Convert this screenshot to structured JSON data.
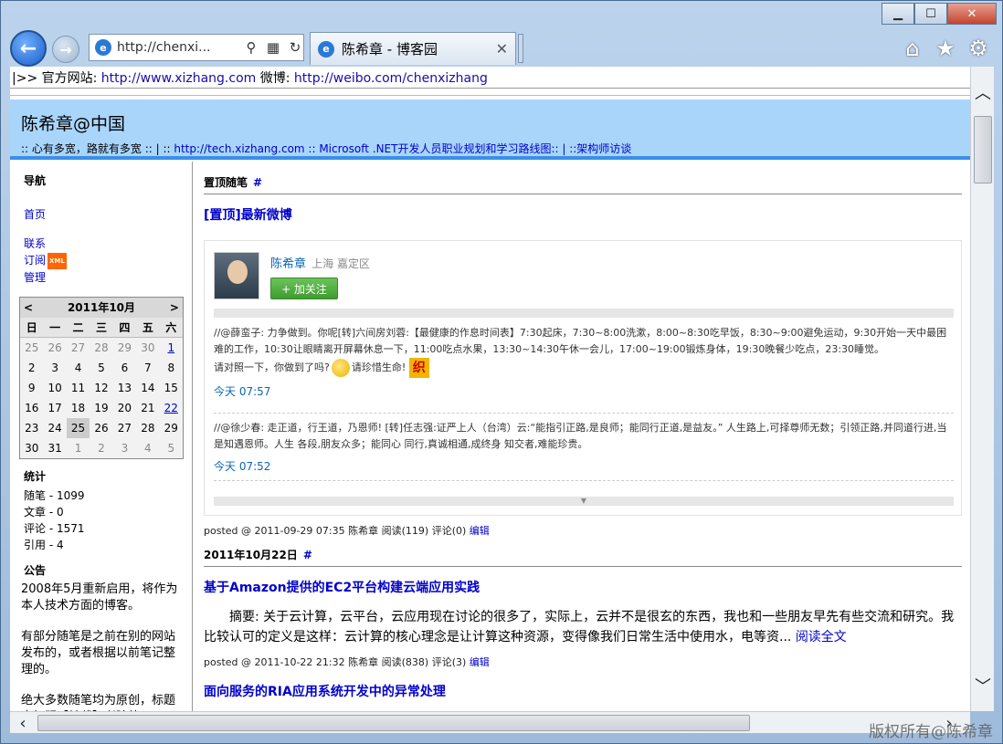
{
  "browser": {
    "address": "http://chenxi...",
    "tab_title": "陈希章 - 博客园",
    "ie_glyph": "e"
  },
  "topline": {
    "prefix": "|>> 官方网站: ",
    "site_url": "http://www.xizhang.com",
    "weibo_label": " 微博: ",
    "weibo_url": "http://weibo.com/chenxizhang"
  },
  "header": {
    "title": "陈希章@中国",
    "motto": ":: 心有多宽，路就有多宽 :: | :: ",
    "tech_link": "http://tech.xizhang.com",
    "link2": " :: Microsoft .NET开发人员职业规划和学习路线图:: | ::架构师访谈"
  },
  "sidebar": {
    "nav_heading": "导航",
    "nav": [
      "首页",
      "联系",
      "订阅",
      "管理"
    ],
    "xml_badge": "XML",
    "calendar": {
      "prev": "<",
      "title": "2011年10月",
      "next": ">",
      "dows": [
        "日",
        "一",
        "二",
        "三",
        "四",
        "五",
        "六"
      ],
      "days": [
        {
          "d": "25",
          "t": "other"
        },
        {
          "d": "26",
          "t": "other"
        },
        {
          "d": "27",
          "t": "other"
        },
        {
          "d": "28",
          "t": "other"
        },
        {
          "d": "29",
          "t": "other"
        },
        {
          "d": "30",
          "t": "other"
        },
        {
          "d": "1",
          "t": "link"
        },
        {
          "d": "2",
          "t": ""
        },
        {
          "d": "3",
          "t": ""
        },
        {
          "d": "4",
          "t": ""
        },
        {
          "d": "5",
          "t": ""
        },
        {
          "d": "6",
          "t": ""
        },
        {
          "d": "7",
          "t": ""
        },
        {
          "d": "8",
          "t": ""
        },
        {
          "d": "9",
          "t": ""
        },
        {
          "d": "10",
          "t": ""
        },
        {
          "d": "11",
          "t": ""
        },
        {
          "d": "12",
          "t": ""
        },
        {
          "d": "13",
          "t": ""
        },
        {
          "d": "14",
          "t": ""
        },
        {
          "d": "15",
          "t": ""
        },
        {
          "d": "16",
          "t": ""
        },
        {
          "d": "17",
          "t": ""
        },
        {
          "d": "18",
          "t": ""
        },
        {
          "d": "19",
          "t": ""
        },
        {
          "d": "20",
          "t": ""
        },
        {
          "d": "21",
          "t": ""
        },
        {
          "d": "22",
          "t": "link"
        },
        {
          "d": "23",
          "t": ""
        },
        {
          "d": "24",
          "t": ""
        },
        {
          "d": "25",
          "t": "today"
        },
        {
          "d": "26",
          "t": ""
        },
        {
          "d": "27",
          "t": ""
        },
        {
          "d": "28",
          "t": ""
        },
        {
          "d": "29",
          "t": ""
        },
        {
          "d": "30",
          "t": ""
        },
        {
          "d": "31",
          "t": ""
        },
        {
          "d": "1",
          "t": "other"
        },
        {
          "d": "2",
          "t": "other"
        },
        {
          "d": "3",
          "t": "other"
        },
        {
          "d": "4",
          "t": "other"
        },
        {
          "d": "5",
          "t": "other"
        }
      ]
    },
    "stats_heading": "统计",
    "stats": [
      "随笔 - 1099",
      "文章 - 0",
      "评论 - 1571",
      "引用 - 4"
    ],
    "notice_heading": "公告",
    "notice": [
      "2008年5月重新启用，将作为本人技术方面的博客。",
      "有部分随笔是之前在别的网站发布的，或者根据以前笔记整理的。",
      "绝大多数随笔均为原创，标题中标明【转载】者除外。"
    ]
  },
  "main": {
    "section1": {
      "title": "置顶随笔",
      "hash": "#"
    },
    "post1": {
      "title": "[置顶]最新微博",
      "foot_prefix": "posted @ 2011-09-29 07:35 陈希章 阅读(119) 评论(0) ",
      "edit": "编辑"
    },
    "weibo": {
      "name": "陈希章",
      "location": "上海 嘉定区",
      "follow": "+ 加关注",
      "item1_a": "//@薛蛮子: 力争做到。你呢[转]六间房刘蓉:【最健康的作息时间表】7:30起床，7:30~8:00洗漱，8:00~8:30吃早饭，8:30~9:00避免运动，9:30开始一天中最困难的工作，10:30让眼睛离开屏幕休息一下，11:00吃点水果，13:30~14:30午休一会儿，17:00~19:00锻炼身体，19:30晚餐少吃点，23:30睡觉。",
      "item1_b": "请对照一下，你做到了吗?",
      "item1_c": "请珍惜生命!",
      "zhi": "织",
      "item1_time": "今天 07:57",
      "item2": "//@徐少春: 走正道，行王道，乃恩师! [转]任志强:证严上人（台湾）云:“能指引正路,是良师；能同行正道,是益友。” 人生路上,可择尊师无数；引领正路,并同道行进,当是知遇恩师。人生 各段,朋友众多；能同心 同行,真诚相通,成终身 知交者,难能珍贵。",
      "item2_time": "今天 07:52",
      "more": "▼"
    },
    "section2": {
      "title": "2011年10月22日",
      "hash": "#"
    },
    "post2": {
      "title": "基于Amazon提供的EC2平台构建云端应用实践",
      "summary": "　　摘要: 关于云计算，云平台，云应用现在讨论的很多了，实际上，云并不是很玄的东西，我也和一些朋友早先有些交流和研究。我比较认可的定义是这样：云计算的核心理念是让计算这种资源，变得像我们日常生活中使用水，电等资... ",
      "read_more": "阅读全文",
      "foot_prefix": "posted @ 2011-10-22 21:32 陈希章 阅读(838) 评论(3) ",
      "edit": "编辑"
    },
    "post3": {
      "title": "面向服务的RIA应用系统开发中的异常处理"
    }
  },
  "watermark": "版权所有@陈希章"
}
